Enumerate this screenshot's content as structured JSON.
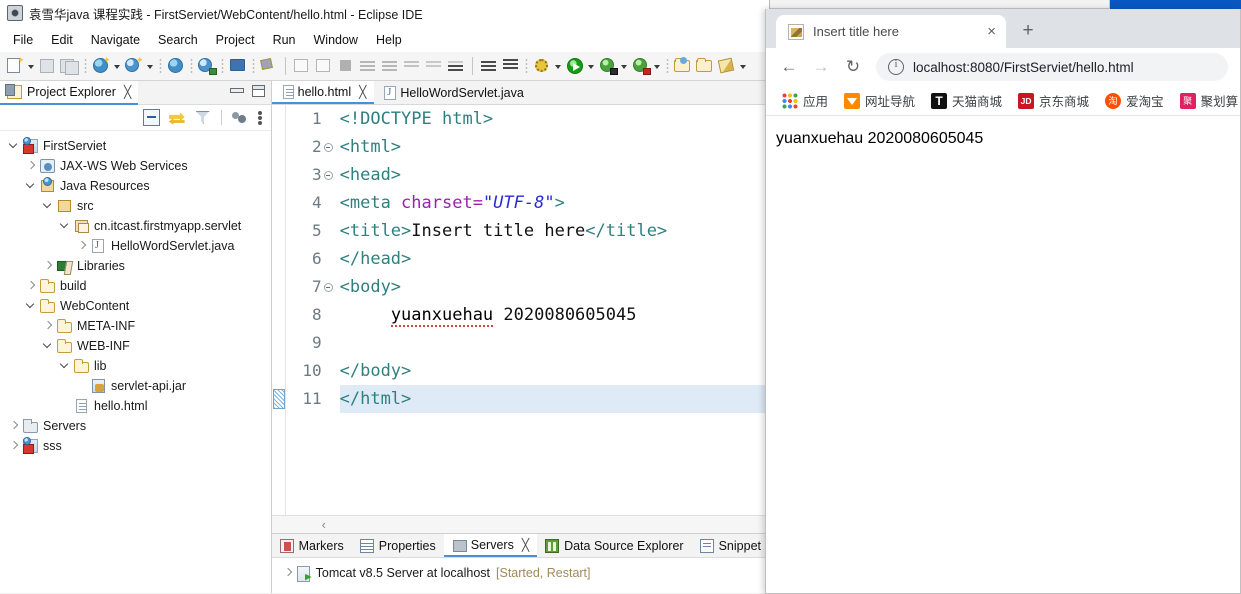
{
  "ide": {
    "title": "袁雪华java 课程实践 - FirstServiet/WebContent/hello.html - Eclipse IDE",
    "window_icon": "eclipse-icon",
    "menus": [
      "File",
      "Edit",
      "Navigate",
      "Search",
      "Project",
      "Run",
      "Window",
      "Help"
    ],
    "toolbar_icons": [
      "new-wizard-icon",
      "new-dropdown-arrow",
      "save-icon",
      "save-all-icon",
      "new-web-project-icon",
      "new-web-dropdown-arrow",
      "new-server-icon",
      "new-server-dropdown-arrow",
      "open-web-browser-icon",
      "open-perspective-icon",
      "open-console-icon",
      "link-break-icon",
      "resume-icon",
      "suspend-icon",
      "terminate-icon",
      "step-into-icon",
      "step-over-icon",
      "step-return-icon",
      "drop-to-frame-icon",
      "use-step-filters-icon",
      "next-annotation-icon",
      "previous-annotation-icon",
      "last-edit-location-icon",
      "debug-icon",
      "debug-dropdown-arrow",
      "run-icon",
      "run-dropdown-arrow",
      "run-as-server-icon",
      "run-as-dropdown-arrow",
      "debug-server-icon",
      "debug-server-dropdown-arrow",
      "open-type-icon",
      "open-resource-icon",
      "new-java-class-icon",
      "new-class-dropdown-arrow"
    ]
  },
  "explorer": {
    "tab_label": "Project Explorer",
    "tab_icon": "project-explorer-icon",
    "close_glyph": "╳",
    "toolbar_icons": [
      "collapse-all-icon",
      "link-with-editor-icon",
      "filter-icon",
      "focus-on-active-task-icon",
      "view-menu-icon"
    ],
    "window_buttons": [
      "minimize-view-button",
      "maximize-view-button"
    ],
    "tree": [
      {
        "label": "FirstServiet",
        "indent": 0,
        "state": "open",
        "icon": "dynamic-web-project-icon"
      },
      {
        "label": "JAX-WS Web Services",
        "indent": 1,
        "state": "closed",
        "icon": "jaxws-icon"
      },
      {
        "label": "Java Resources",
        "indent": 1,
        "state": "open",
        "icon": "java-resources-icon"
      },
      {
        "label": "src",
        "indent": 2,
        "state": "open",
        "icon": "source-folder-icon"
      },
      {
        "label": "cn.itcast.firstmyapp.servlet",
        "indent": 3,
        "state": "open",
        "icon": "package-icon"
      },
      {
        "label": "HelloWordServlet.java",
        "indent": 4,
        "state": "closed",
        "icon": "java-file-icon"
      },
      {
        "label": "Libraries",
        "indent": 2,
        "state": "closed",
        "icon": "libraries-icon"
      },
      {
        "label": "build",
        "indent": 1,
        "state": "closed",
        "icon": "folder-icon"
      },
      {
        "label": "WebContent",
        "indent": 1,
        "state": "open",
        "icon": "folder-icon"
      },
      {
        "label": "META-INF",
        "indent": 2,
        "state": "closed",
        "icon": "folder-icon"
      },
      {
        "label": "WEB-INF",
        "indent": 2,
        "state": "open",
        "icon": "folder-icon"
      },
      {
        "label": "lib",
        "indent": 3,
        "state": "open",
        "icon": "folder-icon"
      },
      {
        "label": "servlet-api.jar",
        "indent": 4,
        "state": "none",
        "icon": "jar-icon"
      },
      {
        "label": "hello.html",
        "indent": 3,
        "state": "none",
        "icon": "html-file-icon"
      },
      {
        "label": "Servers",
        "indent": 0,
        "state": "closed",
        "icon": "servers-folder-icon"
      },
      {
        "label": "sss",
        "indent": 0,
        "state": "closed",
        "icon": "dynamic-web-project-icon"
      }
    ]
  },
  "editor": {
    "tabs": [
      {
        "label": "hello.html",
        "icon": "html-file-icon",
        "active": true,
        "close_glyph": "╳"
      },
      {
        "label": "HelloWordServlet.java",
        "icon": "java-file-icon",
        "active": false
      }
    ],
    "highlighted_line": 11,
    "lines": [
      {
        "num": "1",
        "fold": false,
        "segments": [
          {
            "t": "<!DOCTYPE html>",
            "c": "tag"
          }
        ]
      },
      {
        "num": "2",
        "fold": true,
        "segments": [
          {
            "t": "<html>",
            "c": "tag"
          }
        ]
      },
      {
        "num": "3",
        "fold": true,
        "segments": [
          {
            "t": "<head>",
            "c": "tag"
          }
        ]
      },
      {
        "num": "4",
        "fold": false,
        "segments": [
          {
            "t": "<meta ",
            "c": "tag"
          },
          {
            "t": "charset=",
            "c": "attr"
          },
          {
            "t": "\"UTF-8\"",
            "c": "val"
          },
          {
            "t": ">",
            "c": "tag"
          }
        ]
      },
      {
        "num": "5",
        "fold": false,
        "segments": [
          {
            "t": "<title>",
            "c": "tag"
          },
          {
            "t": "Insert title here",
            "c": "txt"
          },
          {
            "t": "</title>",
            "c": "tag"
          }
        ]
      },
      {
        "num": "6",
        "fold": false,
        "segments": [
          {
            "t": "</head>",
            "c": "tag"
          }
        ]
      },
      {
        "num": "7",
        "fold": true,
        "segments": [
          {
            "t": "<body>",
            "c": "tag"
          }
        ]
      },
      {
        "num": "8",
        "fold": false,
        "segments": [
          {
            "t": "     ",
            "c": "txt"
          },
          {
            "t": "yuanxuehau",
            "c": "spell"
          },
          {
            "t": " 2020080605045",
            "c": "txt"
          }
        ]
      },
      {
        "num": "9",
        "fold": false,
        "segments": [
          {
            "t": "",
            "c": "txt"
          }
        ]
      },
      {
        "num": "10",
        "fold": false,
        "segments": [
          {
            "t": "</body>",
            "c": "tag"
          }
        ]
      },
      {
        "num": "11",
        "fold": false,
        "segments": [
          {
            "t": "</html>",
            "c": "tag"
          }
        ]
      }
    ],
    "hscroll_glyph": "‹"
  },
  "bottom_panel": {
    "tabs": [
      {
        "label": "Markers",
        "icon": "markers-icon",
        "active": false
      },
      {
        "label": "Properties",
        "icon": "properties-icon",
        "active": false
      },
      {
        "label": "Servers",
        "icon": "servers-icon",
        "active": true,
        "close_glyph": "╳"
      },
      {
        "label": "Data Source Explorer",
        "icon": "data-source-explorer-icon",
        "active": false
      },
      {
        "label": "Snippet",
        "icon": "snippets-icon",
        "active": false
      }
    ],
    "server_row": {
      "name": "Tomcat v8.5 Server at localhost",
      "state": "[Started, Restart]",
      "icon": "tomcat-server-icon",
      "expander": "chevron-right-icon"
    }
  },
  "browser": {
    "tab": {
      "title": "Insert title here",
      "favicon": "page-favicon",
      "close_glyph": "×"
    },
    "new_tab_glyph": "+",
    "nav": {
      "back_glyph": "←",
      "forward_glyph": "→",
      "reload_glyph": "↻"
    },
    "omnibox": {
      "url": "localhost:8080/FirstServiet/hello.html",
      "security_icon": "info-circle-icon"
    },
    "bookmarks": [
      {
        "label": "应用",
        "icon": "google-apps-icon"
      },
      {
        "label": "网址导航",
        "icon": "hao123-icon"
      },
      {
        "label": "天猫商城",
        "icon": "tmall-icon"
      },
      {
        "label": "京东商城",
        "icon": "jd-icon"
      },
      {
        "label": "爱淘宝",
        "icon": "taobao-icon"
      },
      {
        "label": "聚划算",
        "icon": "juhuasuan-icon"
      }
    ],
    "page": {
      "text": "yuanxuehau 2020080605045"
    }
  },
  "colors": {
    "accent": "#4a90d9",
    "tag": "#2f7f7f",
    "attr": "#9b21a8",
    "value": "#2a2ad6",
    "title_blue": "#0a57c2",
    "line_highlight": "#dfeaf7"
  }
}
